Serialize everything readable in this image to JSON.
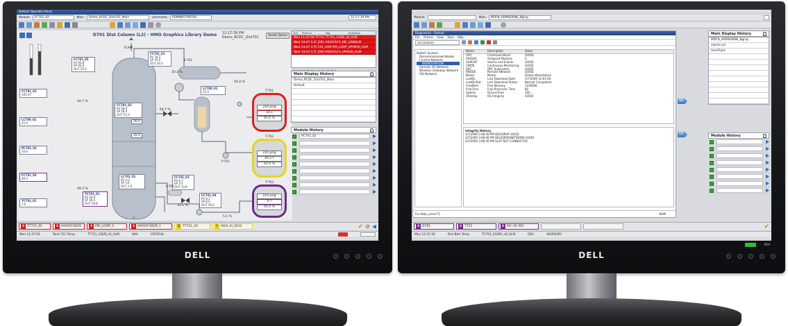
{
  "left": {
    "window_title": "DeltaV Operate (Run)",
    "module_label": "Module",
    "module_value": "FC701_02",
    "main_label": "Main",
    "main_value": "Demo_RCDC_Dist701_Main",
    "username_label": "Username",
    "username_value": "ADMINISTRATOR",
    "clock": "12:17:39 PM",
    "graphic_title": "D701 Dist Column (L2) - HMO Graphics Library Demo",
    "graphic_time": "12:17:39 PM",
    "graphic_display": "Demo_RCDC_Dist701",
    "reset_button": "Reset Demo",
    "faceplates": [
      {
        "tag": "FC701_05",
        "pv": "95.8",
        "sp": "95.8",
        "out": "55.0"
      },
      {
        "tag": "FC701_01",
        "pv": "76.2",
        "sp": "76.0",
        "out": "44.0"
      },
      {
        "tag": "FC701_02",
        "pv": "58.0",
        "sp": "58.0",
        "out": "55.0"
      },
      {
        "tag": "LC701_01",
        "pv": "2.0",
        "sp": "3.0",
        "out": "2.0"
      },
      {
        "tag": "TC701_01",
        "pv": "30.9",
        "sp": "30.0",
        "out": "58.8"
      },
      {
        "tag": "FC701_03",
        "pv": "6.7",
        "sp": "3.0",
        "out": "19.8"
      },
      {
        "tag": "FC701_04",
        "pv": "8.2",
        "sp": "8.0",
        "out": "39.6"
      }
    ],
    "side_tags": [
      "FC701_03",
      "LC700_01",
      "PC701_02",
      "FC701_04",
      "TC701_01"
    ],
    "side_values": [
      "345.97",
      "55.9",
      "50.6",
      "49.0",
      "2.0"
    ],
    "column_vals": [
      "44.7 %",
      "64.7 %",
      "49.3 %",
      "30.2 %",
      "54.4 %",
      "33.1 %",
      "5.1 %",
      "30.0",
      "35.0"
    ],
    "column_labels": [
      "FLARE",
      "E-701",
      "P-701",
      "E-702"
    ],
    "tanks": [
      {
        "name": "T-701",
        "press": "210 psig",
        "level": "18.1",
        "temp": "65.0 %"
      },
      {
        "name": "T-702",
        "press": "220 psig",
        "level": "40.2 F",
        "temp": "62.0 %"
      },
      {
        "name": "T-703",
        "press": "210 psig",
        "level": "9.7",
        "temp": "65.0 %"
      }
    ],
    "alarm_header": [
      "Ack",
      "Time In",
      "Tag",
      "Unit/Area"
    ],
    "alarms": [
      "Mon 11:37:56  TT721     TT721_1SIZE_HI_ALM",
      "Wed 14:47:3   LT_D01    HIGHV1F4_HIF_LOWALM",
      "Wed 14:47:3   PC720_LOW PID_LOOP_UPHIGH_ALM",
      "Wed 14:47:3   LT_D00    HIGHV1F4_UPHIGH_ALM"
    ],
    "alarm_footer": "Alarm list: Alarms: 4  Unacked: 4",
    "main_history_title": "Main Display History",
    "main_history": [
      "Demo_RCDC_Dist701_Main",
      "Default",
      "",
      "",
      "",
      "",
      "",
      ""
    ],
    "module_history_title": "Module History",
    "module_history": [
      "PC701_02",
      "",
      "",
      "",
      "",
      "",
      "",
      "",
      ""
    ],
    "bottom_alarms": [
      {
        "sev": "3",
        "tag": "TT721_01",
        "color": "#d81e1e"
      },
      {
        "sev": "3",
        "tag": "HIHV1F4D29",
        "color": "#d81e1e"
      },
      {
        "sev": "3",
        "tag": "PID_LOOP_3",
        "color": "#d81e1e"
      },
      {
        "sev": "3",
        "tag": "HIHV1F4D29_1",
        "color": "#d81e1e"
      },
      {
        "sev": "2",
        "tag": "TT721_03",
        "color": "#e8cf14"
      },
      {
        "sev": "!",
        "tag": "AI04_AI_3012",
        "color": "#e8cf14"
      }
    ],
    "status": [
      "Mon 11:37:56",
      "Tank-721 Temp",
      "TT721_1SIZE_HI_ALM",
      "HIHI",
      "CRITICAL"
    ]
  },
  "right": {
    "module_label": "Module",
    "main_label": "Main",
    "main_value": "MDFN_ADMSDENE_Bgray",
    "explorer_title": "Diagnostics - Default",
    "explorer_menu": [
      "File",
      "Actions",
      "View",
      "Tools",
      "Help"
    ],
    "tree_root": "DELTAVSRVR",
    "tree_items": [
      "DeltaV System",
      "Decommissioned Nodes",
      "Control Network",
      "WORKSTATION",
      "Remote I/O Network",
      "Wireless Gateway Network",
      "SIS Network"
    ],
    "list_header": [
      "Name",
      "Description",
      "Value"
    ],
    "list_rows": [
      [
        "CPU",
        "Communications",
        "GOOD"
      ],
      [
        "ASSIGN",
        "Assigned Modules",
        "0"
      ],
      [
        "ALMCNT",
        "Alarms and Events",
        "GOOD"
      ],
      [
        "CMON",
        "Continuous Monitoring",
        "GOOD"
      ],
      [
        "OPC",
        "OPC Subsystem",
        "GOOD"
      ],
      [
        "RNODE",
        "Remote Network",
        "GOOD"
      ],
      [
        "Model",
        "Model",
        "Deltav Workstation"
      ],
      [
        "LastDL",
        "Last Download Date",
        "3/7/2009 12:01:00"
      ],
      [
        "LastDLStat",
        "Last Download Status",
        "Normal Completion"
      ],
      [
        "FreeMem",
        "Free Memory",
        "1240000"
      ],
      [
        "FreeTime",
        "Free Processor Time",
        "80"
      ],
      [
        "Uptime",
        "OnLineTime",
        "300"
      ],
      [
        "OSInteg",
        "OS Integrity",
        "GOOD"
      ]
    ],
    "log_title": "Integrity History",
    "log_lines": [
      "3/7/2009 3:48:49 PM  DELVSRVR  GOOD",
      "3/7/2009 3:48:49 PM  DELVSRVR/NETWORK  GOOD",
      "3/7/2009 3:48:49 PM  SLOT  NOT CONNECTED"
    ],
    "explorer_status": "For Help, press F1",
    "explorer_status_right": "NUM",
    "main_history_title": "Main Display History",
    "main_history": [
      "MDFN_ADMSDENE_Bgray",
      "alarmI.xsl",
      "UserPlant",
      "",
      "",
      "",
      "",
      "",
      "",
      "",
      "",
      ""
    ],
    "module_history_title": "Module History",
    "module_history": [
      "",
      "",
      "",
      "",
      "",
      "",
      "",
      "",
      "",
      ""
    ],
    "bottom_alarms": [
      {
        "sev": "3",
        "tag": "D701",
        "color": "#7a2b8f"
      },
      {
        "sev": "3",
        "tag": "T721",
        "color": "#7a2b8f"
      },
      {
        "sev": "3",
        "tag": "PIC-10-301",
        "color": "#7a2b8f"
      }
    ],
    "status": [
      "Mon 12:37:30",
      "Dist Btm Temp",
      "TC701_01DEV_HI_ALM",
      "DEV",
      "ADVISORY"
    ],
    "corner_status": "9UH"
  },
  "monitor_brand": "DELL",
  "tank_colors": [
    "#d91f1f",
    "#e6d51a",
    "#6b2a86"
  ]
}
